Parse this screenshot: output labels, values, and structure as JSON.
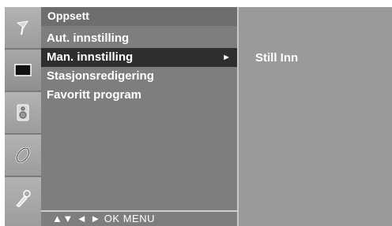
{
  "menu": {
    "title": "Oppsett",
    "items": [
      {
        "label": "Aut. innstilling",
        "selected": false
      },
      {
        "label": "Man. innstilling",
        "selected": true,
        "arrow": "►"
      },
      {
        "label": "Stasjonsredigering",
        "selected": false
      },
      {
        "label": "Favoritt program",
        "selected": false
      }
    ],
    "footer": "▲▼  ◄ ►  OK  MENU"
  },
  "panel": {
    "value": "Still Inn"
  },
  "rail": {
    "icons": [
      "antenna-icon",
      "picture-icon",
      "audio-icon",
      "time-icon",
      "option-icon"
    ]
  },
  "colors": {
    "osd_bg": "#8e8e8e",
    "menu_bg": "#7e7e7e",
    "selected_bg": "#2e2e2e",
    "text": "#ffffff"
  }
}
